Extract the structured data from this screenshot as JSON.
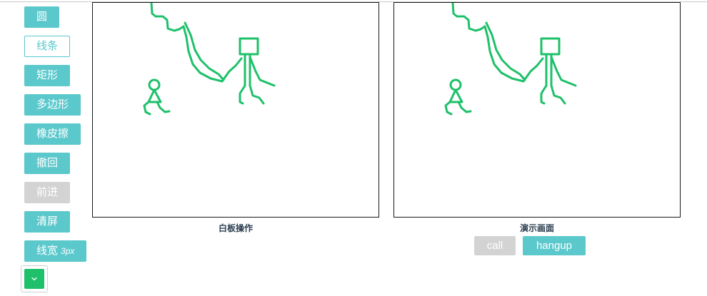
{
  "toolbar": {
    "circle": "圆",
    "line": "线条",
    "rect": "矩形",
    "polygon": "多边形",
    "eraser": "橡皮擦",
    "undo": "撤回",
    "redo": "前进",
    "clear": "清屏",
    "line_width_label": "线宽",
    "line_width_value": "3px",
    "pen_color": "#1ec06a",
    "picker_icon": "chevron-down-icon"
  },
  "whiteboard": {
    "caption": "白板操作"
  },
  "preview": {
    "caption": "演示画面",
    "call_label": "call",
    "hangup_label": "hangup"
  },
  "colors": {
    "accent": "#5bc8cc",
    "disabled": "#d3d3d3",
    "stroke": "#1ec06a"
  }
}
